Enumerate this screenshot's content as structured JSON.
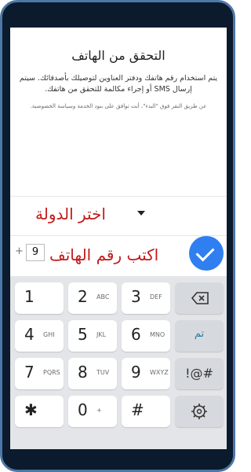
{
  "verify": {
    "title": "التحقق من الهاتف",
    "description": "يتم استخدام رقم هاتفك ودفتر العناوين لتوصيلك بأصدقائك. سيتم إرسال SMS أو إجراء مكالمة للتحقق من هاتفك.",
    "terms": "عن طريق النقر فوق \"البدء\"، أنت توافق على بنود الخدمة وسياسة الخصوصية."
  },
  "country": {
    "label": "اختر الدولة"
  },
  "phone": {
    "plus": "+",
    "code": "9",
    "hint": "اكتب رقم الهاتف"
  },
  "keypad": {
    "keys": [
      {
        "digit": "1",
        "letters": ""
      },
      {
        "digit": "2",
        "letters": "ABC"
      },
      {
        "digit": "3",
        "letters": "DEF"
      },
      {
        "digit": "4",
        "letters": "GHI"
      },
      {
        "digit": "5",
        "letters": "JKL"
      },
      {
        "digit": "6",
        "letters": "MNO"
      },
      {
        "digit": "7",
        "letters": "PQRS"
      },
      {
        "digit": "8",
        "letters": "TUV"
      },
      {
        "digit": "9",
        "letters": "WXYZ"
      },
      {
        "digit": "✱",
        "letters": ""
      },
      {
        "digit": "0",
        "letters": "+"
      },
      {
        "digit": "#",
        "letters": ""
      }
    ],
    "done_label": "تم",
    "symbols_label": "!@#"
  },
  "icons": {
    "submit": "check-icon",
    "backspace": "backspace-icon",
    "settings": "gear-icon",
    "dropdown": "dropdown-arrow-icon"
  },
  "colors": {
    "accent": "#2f7ff0",
    "hint_red": "#c21a1a",
    "frame": "#4b78a6"
  }
}
